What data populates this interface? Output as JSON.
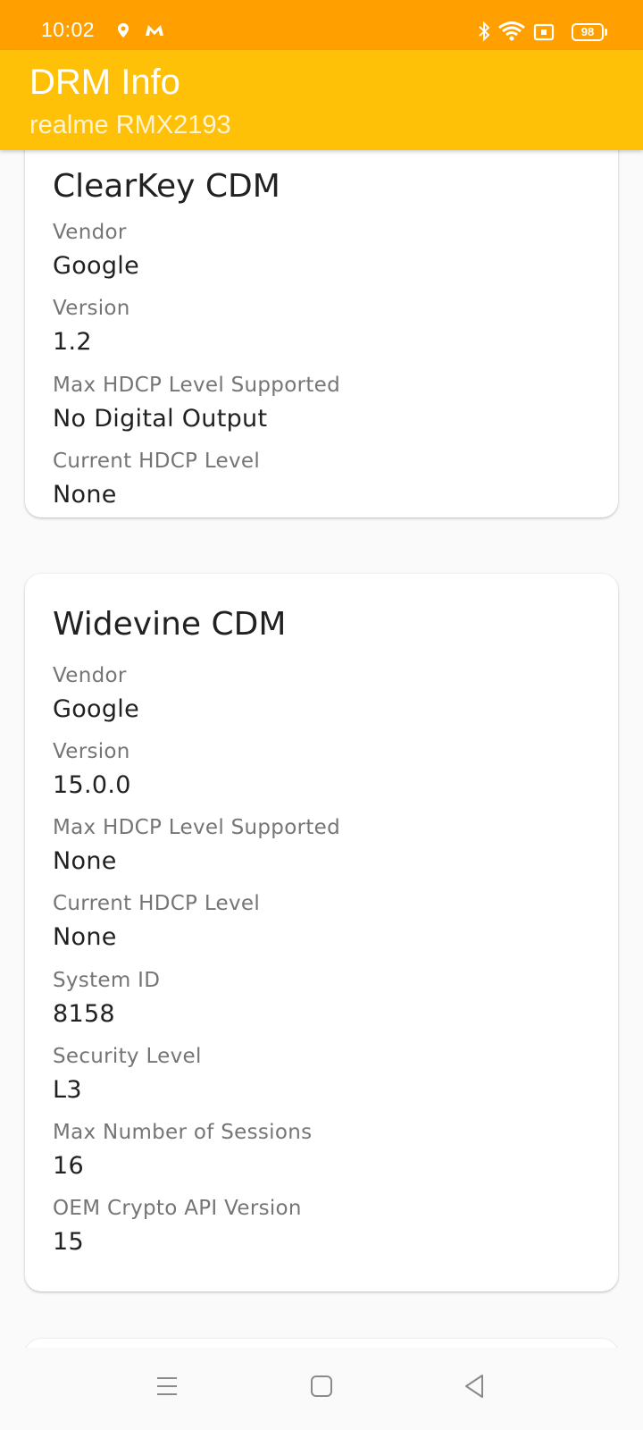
{
  "status_bar": {
    "time": "10:02",
    "battery": "98",
    "icons": [
      "location-icon",
      "app-notification-icon",
      "bluetooth-icon",
      "wifi-icon",
      "cast-icon",
      "battery-icon"
    ]
  },
  "app_bar": {
    "title": "DRM Info",
    "subtitle": "realme RMX2193",
    "color": "#ffc107"
  },
  "cards": [
    {
      "title": "ClearKey CDM",
      "properties": [
        {
          "label": "Vendor",
          "value": "Google"
        },
        {
          "label": "Version",
          "value": "1.2"
        },
        {
          "label": "Max HDCP Level Supported",
          "value": "No Digital Output"
        },
        {
          "label": "Current HDCP Level",
          "value": "None"
        }
      ]
    },
    {
      "title": "Widevine CDM",
      "properties": [
        {
          "label": "Vendor",
          "value": "Google"
        },
        {
          "label": "Version",
          "value": "15.0.0"
        },
        {
          "label": "Max HDCP Level Supported",
          "value": "None"
        },
        {
          "label": "Current HDCP Level",
          "value": "None"
        },
        {
          "label": "System ID",
          "value": "8158"
        },
        {
          "label": "Security Level",
          "value": "L3"
        },
        {
          "label": "Max Number of Sessions",
          "value": "16"
        },
        {
          "label": "OEM Crypto API Version",
          "value": "15"
        }
      ]
    }
  ],
  "nav_bar": {
    "icons": [
      "menu-icon",
      "home-icon",
      "back-icon"
    ]
  },
  "colors": {
    "status_bar": "#ffa000",
    "app_bar": "#ffc107",
    "label": "#757575",
    "value": "#212121"
  }
}
